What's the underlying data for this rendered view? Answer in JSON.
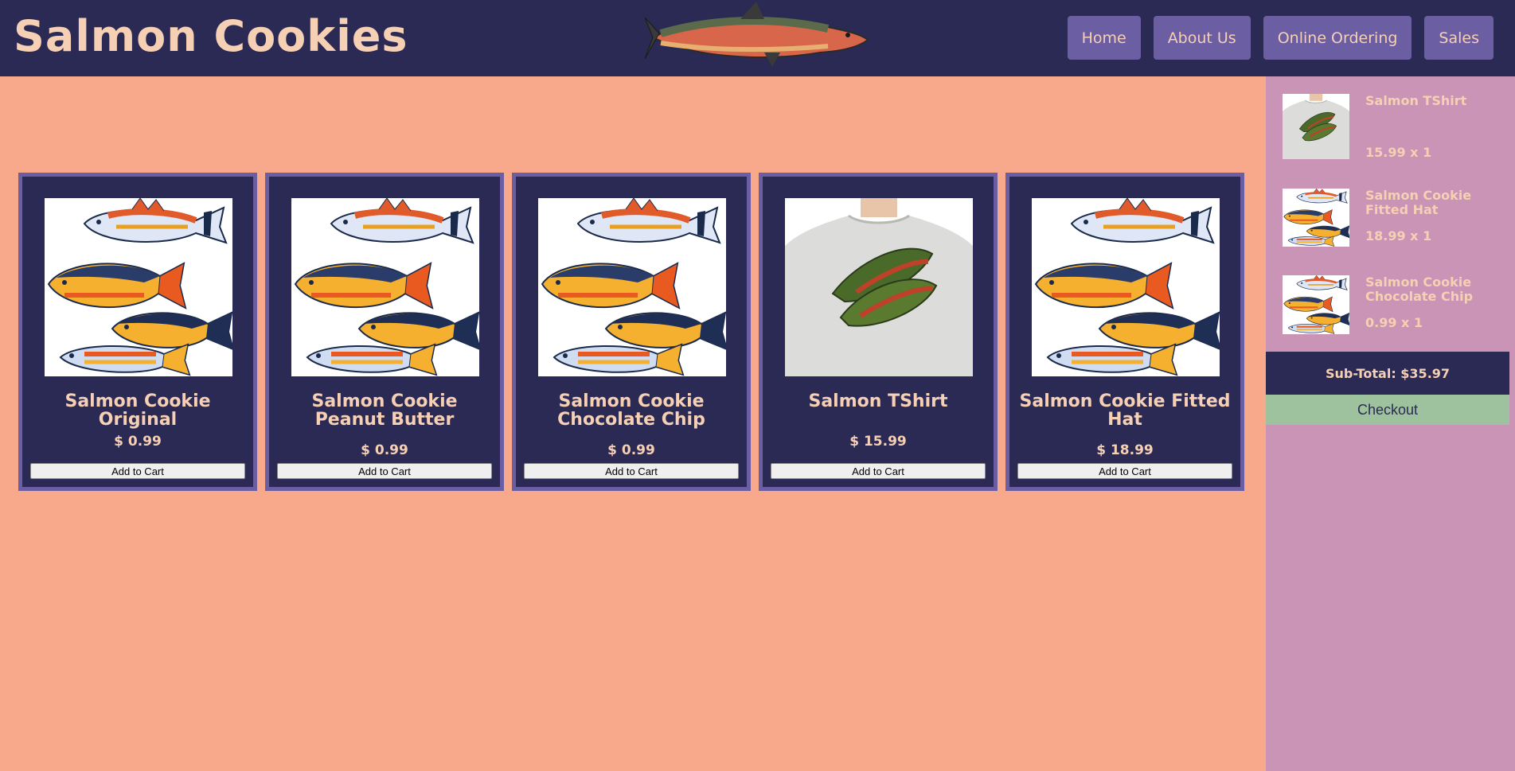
{
  "header": {
    "brand": "Salmon Cookies",
    "logo_icon": "salmon-fish-icon",
    "nav": [
      {
        "label": "Home"
      },
      {
        "label": "About Us"
      },
      {
        "label": "Online Ordering"
      },
      {
        "label": "Sales"
      }
    ]
  },
  "products": [
    {
      "name": "Salmon Cookie Original",
      "price": "$ 0.99",
      "button": "Add to Cart",
      "image": "salmon-group-image"
    },
    {
      "name": "Salmon Cookie Peanut Butter",
      "price": "$ 0.99",
      "button": "Add to Cart",
      "image": "salmon-group-image"
    },
    {
      "name": "Salmon Cookie Chocolate Chip",
      "price": "$ 0.99",
      "button": "Add to Cart",
      "image": "salmon-group-image"
    },
    {
      "name": "Salmon TShirt",
      "price": "$ 15.99",
      "button": "Add to Cart",
      "image": "salmon-tshirt-image"
    },
    {
      "name": "Salmon Cookie Fitted Hat",
      "price": "$ 18.99",
      "button": "Add to Cart",
      "image": "salmon-group-image"
    }
  ],
  "cart": {
    "items": [
      {
        "name": "Salmon TShirt",
        "qty": "15.99 x 1",
        "image": "salmon-tshirt-image"
      },
      {
        "name": "Salmon Cookie Fitted Hat",
        "qty": "18.99 x 1",
        "image": "salmon-group-image"
      },
      {
        "name": "Salmon Cookie Chocolate Chip",
        "qty": "0.99 x 1",
        "image": "salmon-group-image"
      }
    ],
    "subtotal": "Sub-Total: $35.97",
    "checkout": "Checkout"
  },
  "colors": {
    "header_bg": "#2b2a55",
    "page_bg": "#f9a98b",
    "accent": "#6b5ea3",
    "text": "#f6d0b4",
    "sidebar_bg": "#c994b5",
    "checkout_bg": "#9ec29d"
  }
}
